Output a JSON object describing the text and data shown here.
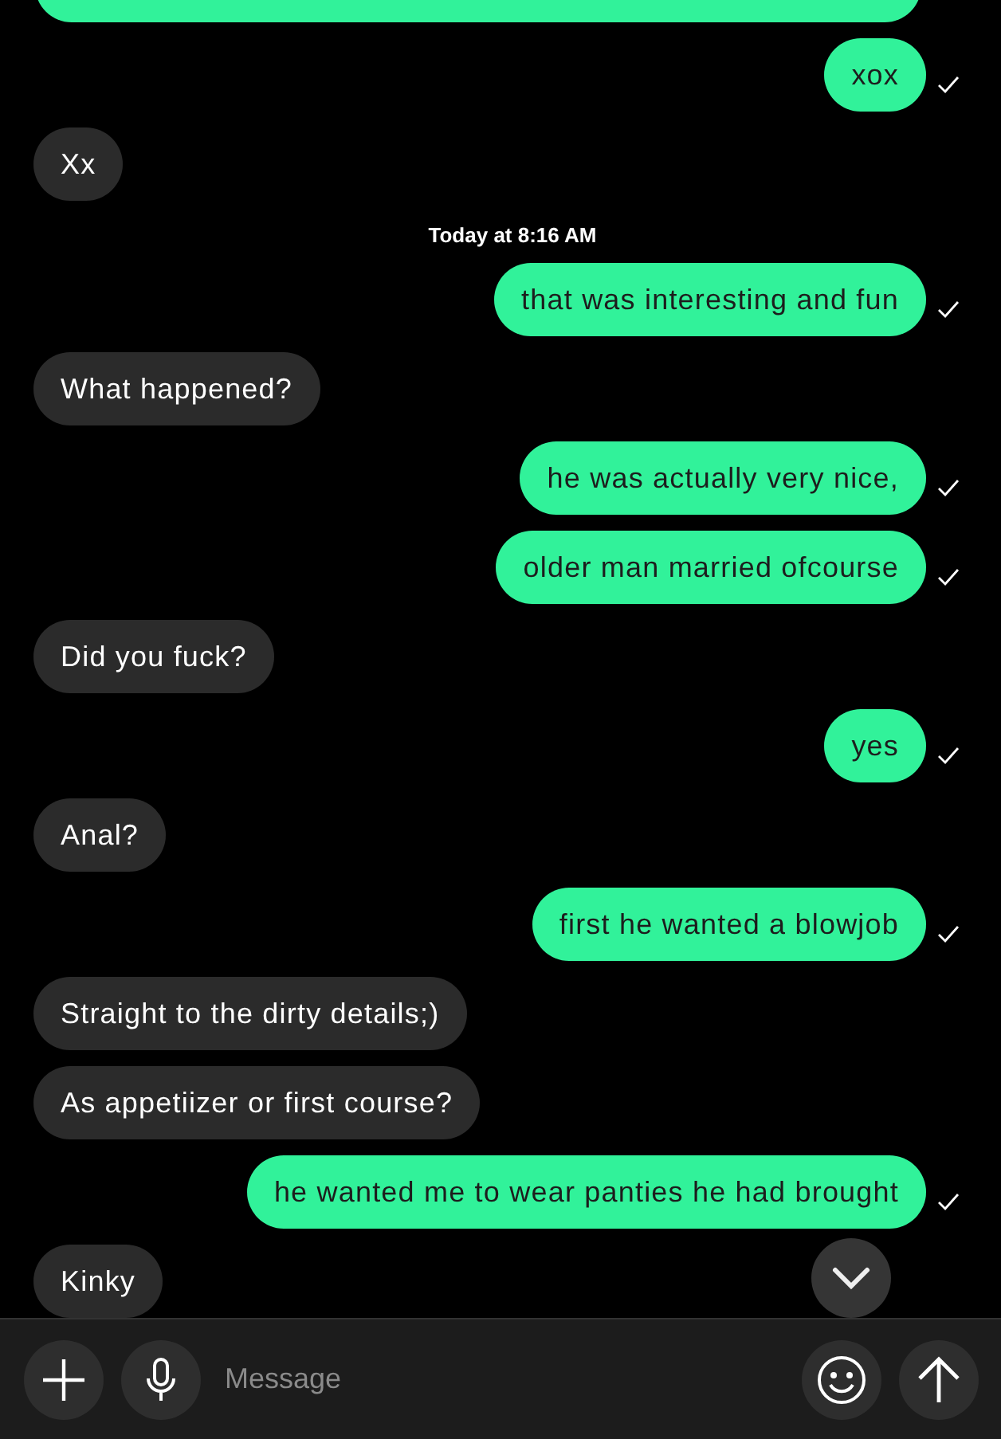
{
  "messages": [
    {
      "kind": "clipped"
    },
    {
      "kind": "sent",
      "text": "xox",
      "delivered": true
    },
    {
      "kind": "received",
      "text": "Xx"
    },
    {
      "kind": "timestamp",
      "text": "Today at 8:16 AM"
    },
    {
      "kind": "sent",
      "text": "that was interesting and fun",
      "delivered": true
    },
    {
      "kind": "received",
      "text": "What happened?"
    },
    {
      "kind": "sent",
      "text": "he was actually very nice,",
      "delivered": true
    },
    {
      "kind": "sent",
      "text": "older man married ofcourse",
      "delivered": true
    },
    {
      "kind": "received",
      "text": "Did you fuck?"
    },
    {
      "kind": "sent",
      "text": "yes",
      "delivered": true
    },
    {
      "kind": "received",
      "text": "Anal?"
    },
    {
      "kind": "sent",
      "text": "first he wanted a blowjob",
      "delivered": true
    },
    {
      "kind": "received",
      "text": "Straight to the dirty details;)"
    },
    {
      "kind": "received",
      "text": "As appetiizer or first course?"
    },
    {
      "kind": "sent",
      "text": "he wanted me to wear panties he had brought",
      "delivered": true
    },
    {
      "kind": "received",
      "text": "Kinky"
    }
  ],
  "composer": {
    "placeholder": "Message"
  }
}
